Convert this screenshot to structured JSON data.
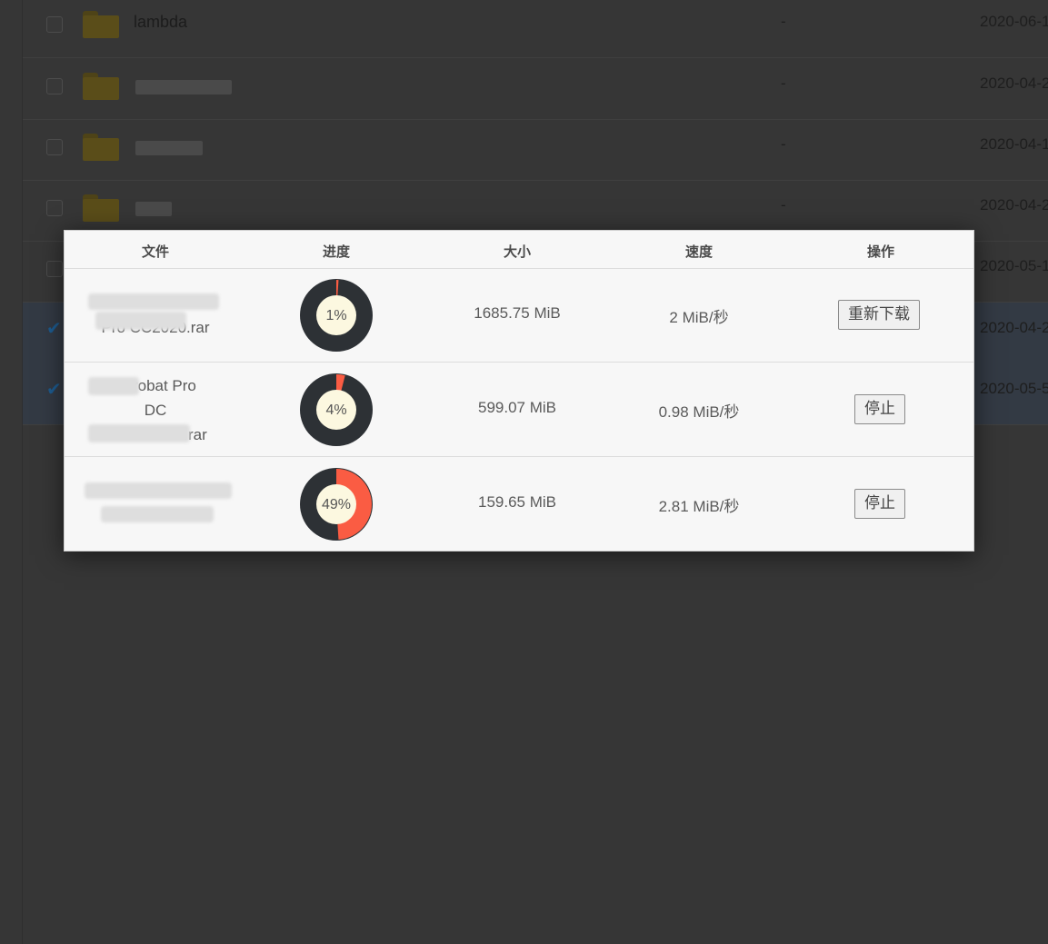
{
  "background_list": {
    "rows": [
      {
        "name": "lambda",
        "size": "-",
        "date": "2020-06-1",
        "checked": false
      },
      {
        "name": "",
        "size": "-",
        "date": "2020-04-2",
        "checked": false
      },
      {
        "name": "",
        "size": "-",
        "date": "2020-04-1",
        "checked": false
      },
      {
        "name": "",
        "size": "-",
        "date": "2020-04-2",
        "checked": false
      },
      {
        "name": "",
        "size": "-",
        "date": "2020-05-1",
        "checked": false
      },
      {
        "name": "",
        "size": "",
        "date": "2020-04-2",
        "checked": true
      },
      {
        "name": "",
        "size": "",
        "date": "2020-05-5",
        "checked": true
      }
    ]
  },
  "download_dialog": {
    "headers": {
      "file": "文件",
      "progress": "进度",
      "size": "大小",
      "speed": "速度",
      "action": "操作"
    },
    "rows": [
      {
        "file_lines": [
          "Pro CC2020.rar"
        ],
        "progress_percent": 1,
        "progress_label": "1%",
        "size": "1685.75 MiB",
        "speed": "2 MiB/秒",
        "action_label": "重新下载"
      },
      {
        "file_lines": [
          "Acrobat Pro",
          "DC",
          ".rar"
        ],
        "progress_percent": 4,
        "progress_label": "4%",
        "size": "599.07 MiB",
        "speed": "0.98 MiB/秒",
        "action_label": "停止"
      },
      {
        "file_lines": [],
        "progress_percent": 49,
        "progress_label": "49%",
        "size": "159.65 MiB",
        "speed": "2.81 MiB/秒",
        "action_label": "停止"
      }
    ],
    "colors": {
      "ring_track": "#2d3135",
      "ring_progress": "#fa5c43",
      "ring_center": "#fcf8e0"
    }
  }
}
